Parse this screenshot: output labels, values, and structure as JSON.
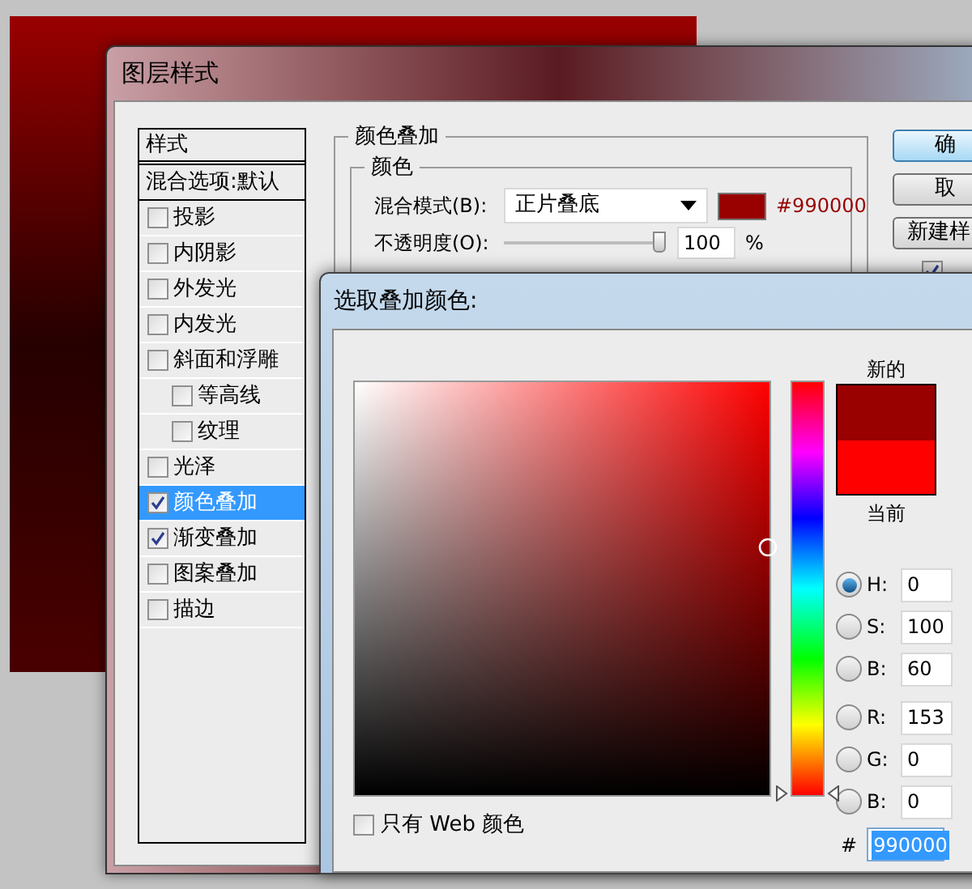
{
  "layer_style_dialog": {
    "title": "图层样式",
    "styles_list": {
      "header": "样式",
      "blending_options": "混合选项:默认",
      "items": [
        {
          "label": "投影",
          "checked": false,
          "selected": false
        },
        {
          "label": "内阴影",
          "checked": false,
          "selected": false
        },
        {
          "label": "外发光",
          "checked": false,
          "selected": false
        },
        {
          "label": "内发光",
          "checked": false,
          "selected": false
        },
        {
          "label": "斜面和浮雕",
          "checked": false,
          "selected": false,
          "children": [
            {
              "label": "等高线",
              "checked": false,
              "selected": false
            },
            {
              "label": "纹理",
              "checked": false,
              "selected": false
            }
          ]
        },
        {
          "label": "光泽",
          "checked": false,
          "selected": false
        },
        {
          "label": "颜色叠加",
          "checked": true,
          "selected": true
        },
        {
          "label": "渐变叠加",
          "checked": true,
          "selected": false
        },
        {
          "label": "图案叠加",
          "checked": false,
          "selected": false
        },
        {
          "label": "描边",
          "checked": false,
          "selected": false
        }
      ]
    },
    "color_overlay": {
      "title": "颜色叠加",
      "group": "颜色",
      "blend_mode_label": "混合模式(B):",
      "blend_mode": "正片叠底",
      "color": "#990000",
      "color_text": "#990000",
      "opacity_label": "不透明度(O):",
      "opacity": {
        "level": 1
      },
      "opacity_value": "100",
      "opacity_unit": "%"
    },
    "buttons": [
      {
        "label": "确",
        "default": true
      },
      {
        "label": "取",
        "default": false
      },
      {
        "label": "新建样",
        "default": false
      }
    ],
    "preview_checkbox": {
      "checked": true
    }
  },
  "color_picker": {
    "title": "选取叠加颜色:",
    "new_swatch": {
      "label": "新的",
      "color": "#990000"
    },
    "current_swatch": {
      "label": "当前",
      "color": "#ff0000"
    },
    "hue_slider": {
      "level": 0
    },
    "fields": [
      {
        "label": "H:",
        "value": "0",
        "selected": true
      },
      {
        "label": "S:",
        "value": "100",
        "selected": false
      },
      {
        "label": "B:",
        "value": "60",
        "selected": false
      },
      {
        "label": "R:",
        "value": "153",
        "selected": false
      },
      {
        "label": "G:",
        "value": "0",
        "selected": false
      },
      {
        "label": "B:",
        "value": "0",
        "selected": false
      }
    ],
    "web_only": {
      "label": "只有 Web 颜色",
      "checked": false
    },
    "hex_label": "#",
    "hex": "990000"
  }
}
